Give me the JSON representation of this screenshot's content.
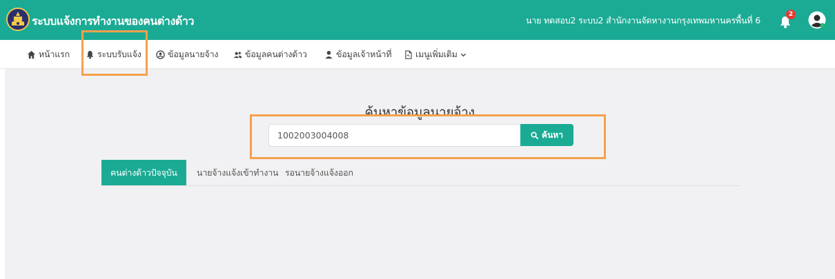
{
  "header": {
    "app_title": "ระบบแจ้งการทำงานของคนต่างด้าว",
    "user_text": "นาย ทดสอบ2 ระบบ2 สำนักงานจัดหางานกรุงเทพมหานครพื้นที่ 6",
    "notification_count": "2"
  },
  "nav": {
    "items": [
      {
        "label": "หน้าแรก",
        "icon": "home-icon"
      },
      {
        "label": "ระบบรับแจ้ง",
        "icon": "bell-icon"
      },
      {
        "label": "ข้อมูลนายจ้าง",
        "icon": "user-circle-icon"
      },
      {
        "label": "ข้อมูลคนต่างด้าว",
        "icon": "users-icon"
      },
      {
        "label": "ข้อมูลเจ้าหน้าที่",
        "icon": "user-icon"
      },
      {
        "label": "เมนูเพิ่มเติม",
        "icon": "document-icon"
      }
    ]
  },
  "search": {
    "title": "ค้นหาข้อมูลนายจ้าง",
    "value": "1002003004008",
    "button_label": "ค้นหา"
  },
  "tabs": [
    {
      "label": "คนต่างด้าวปัจจุบัน",
      "active": true
    },
    {
      "label": "นายจ้างแจ้งเข้าทำงาน",
      "active": false
    },
    {
      "label": "รอนายจ้างแจ้งออก",
      "active": false
    }
  ],
  "colors": {
    "primary": "#1bab95",
    "highlight": "#f5a04a",
    "badge": "#e53935"
  }
}
